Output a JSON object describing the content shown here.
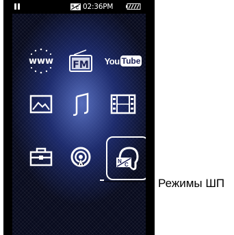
{
  "status_bar": {
    "time": "02:36PM",
    "icons": [
      "pause-icon",
      "noise-cancel-icon",
      "battery-icon"
    ]
  },
  "home_menu": {
    "icons": [
      {
        "name": "www-icon"
      },
      {
        "name": "fm-radio-icon",
        "text": "FM"
      },
      {
        "name": "youtube-icon",
        "text_you": "You",
        "text_tube": "Tube"
      },
      {
        "name": "photo-icon"
      },
      {
        "name": "music-icon"
      },
      {
        "name": "video-icon"
      },
      {
        "name": "settings-toolbox-icon"
      },
      {
        "name": "podcast-icon"
      },
      {
        "name": "noise-cancel-mode-icon",
        "selected": true
      }
    ]
  },
  "callout": {
    "label": "Режимы ШП"
  },
  "colors": {
    "background_deep": "#080b1e",
    "background_glow": "#5f78cd",
    "icon": "#ffffff",
    "callout_text": "#000000"
  }
}
